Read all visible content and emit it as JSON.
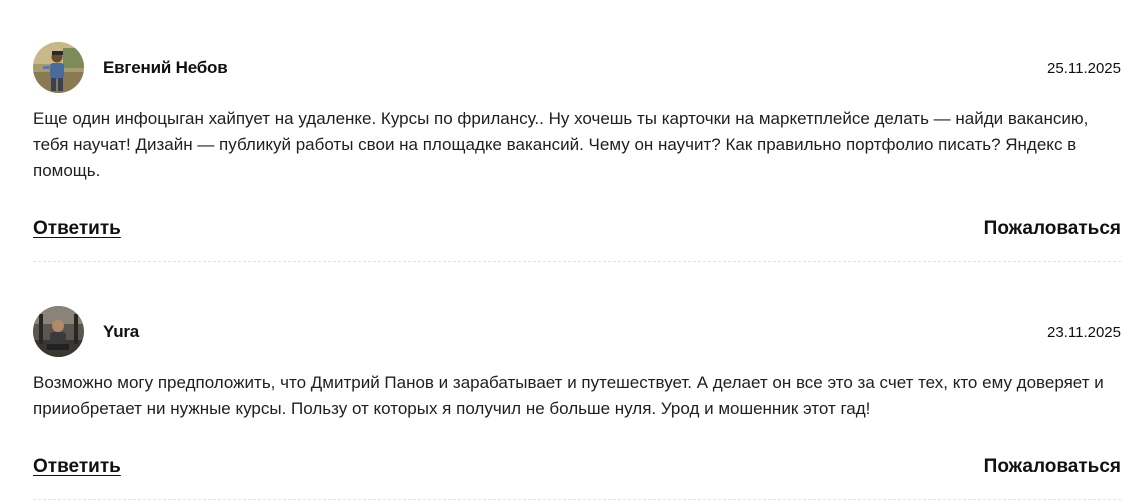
{
  "comments": [
    {
      "author": "Евгений Небов",
      "date": "25.11.2025",
      "text": "Еще один инфоцыган хайпует на удаленке. Курсы по фрилансу.. Ну хочешь ты карточки на маркетплейсе делать — найди вакансию, тебя научат! Дизайн — публикуй работы свои на площадке вакансий. Чему он научит? Как правильно портфолио писать? Яндекс в помощь.",
      "reply_label": "Ответить",
      "complain_label": "Пожаловаться"
    },
    {
      "author": "Yura",
      "date": "23.11.2025",
      "text": "Возможно могу предположить, что Дмитрий Панов и зарабатывает и путешествует. А делает он все это за счет тех, кто ему доверяет и прииобретает ни нужные курсы. Пользу от которых я получил не больше нуля. Урод и мошенник этот гад!",
      "reply_label": "Ответить",
      "complain_label": "Пожаловаться"
    }
  ],
  "colors": {
    "text": "#1a1a1a",
    "divider": "#e2e2e2"
  }
}
